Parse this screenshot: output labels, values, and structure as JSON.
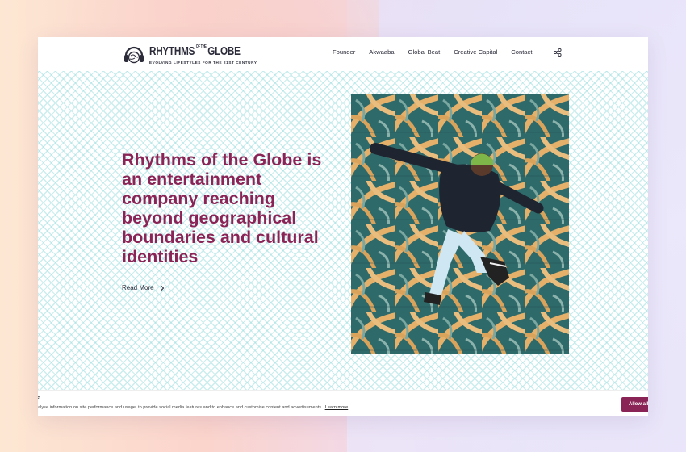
{
  "brand": {
    "name_top": "RHYTHMS",
    "name_of": "OF THE",
    "name_bottom": "GLOBE",
    "tagline": "EVOLVING LIFESTYLES FOR THE 21ST CENTURY"
  },
  "nav": {
    "items": [
      "Founder",
      "Akwaaba",
      "Global Beat",
      "Creative Capital",
      "Contact"
    ]
  },
  "icons": {
    "share": "share-icon",
    "chevron": "chevron-right-icon",
    "logo": "headphone-globe-icon"
  },
  "hero": {
    "headline": "Rhythms of the Globe is an entertainment company reaching beyond geographical boundaries and cultural identities",
    "read_more": "Read More"
  },
  "cookie": {
    "heading": "e",
    "message": "alyse information on site performance and usage, to provide social media features and to enhance and customise content and advertisements.",
    "learn_more": "Learn more",
    "allow": "Allow all"
  },
  "colors": {
    "accent": "#8b2456",
    "pattern": "#a0dee0",
    "text": "#2b2b3a"
  }
}
